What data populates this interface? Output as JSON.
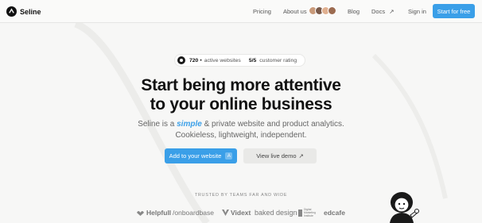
{
  "nav": {
    "brand": "Seline",
    "links": [
      "Pricing",
      "About us",
      "Blog",
      "Docs",
      "Sign in"
    ],
    "docs_arrow": "↗",
    "cta": "Start for free",
    "avatar_colors": [
      "#c99a7a",
      "#7a5a4a",
      "#e0b090",
      "#9c6b50"
    ]
  },
  "stats": {
    "active_count": "720",
    "active_dot": "•",
    "active_label": "active websites",
    "rating_value": "5/5",
    "rating_label": "customer rating"
  },
  "hero": {
    "headline_line1": "Start being more attentive",
    "headline_line2": "to your online business",
    "sub_pre": "Seline is a ",
    "sub_em": "simple",
    "sub_post": " & private website and product analytics.",
    "sub_line2": "Cookieless, lightweight, independent."
  },
  "buttons": {
    "primary": "Add to your website",
    "primary_key": "A",
    "secondary": "View live demo",
    "secondary_arrow": "↗"
  },
  "trusted": {
    "heading": "TRUSTED BY TEAMS FAR AND WIDE",
    "logos": [
      "Helpfull",
      "/onboardbase",
      "Vidext",
      "baked design",
      "Digital Marketing Institute",
      "edcafe"
    ]
  },
  "colors": {
    "accent": "#3a9fe8",
    "background": "#f7f7f6",
    "text": "#111111"
  }
}
